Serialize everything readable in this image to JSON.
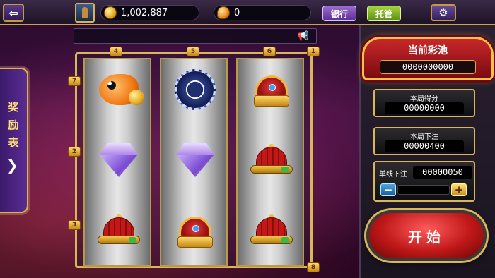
{
  "header": {
    "coins": "1,002,887",
    "beans": "0",
    "bank_label": "银行",
    "auto_label": "托管"
  },
  "reward_tab": {
    "label": "奖励表"
  },
  "jackpot": {
    "title": "当前彩池",
    "value": "0000000000"
  },
  "round_score": {
    "label": "本局得分",
    "value": "00000000"
  },
  "round_bet": {
    "label": "本局下注",
    "value": "00000400"
  },
  "line_bet": {
    "label": "单线下注",
    "value": "00000050"
  },
  "start_label": "开始",
  "line_markers": {
    "top": [
      "4",
      "5",
      "6"
    ],
    "right_top": "1",
    "left": [
      "7",
      "2",
      "3"
    ],
    "bottom_right": "8"
  },
  "reels": [
    [
      "clownfish-coin",
      "purple-diamond",
      "red-hat"
    ],
    [
      "blue-poker-chip",
      "purple-diamond",
      "gold-crown"
    ],
    [
      "gold-crown",
      "red-hat",
      "red-hat"
    ]
  ]
}
